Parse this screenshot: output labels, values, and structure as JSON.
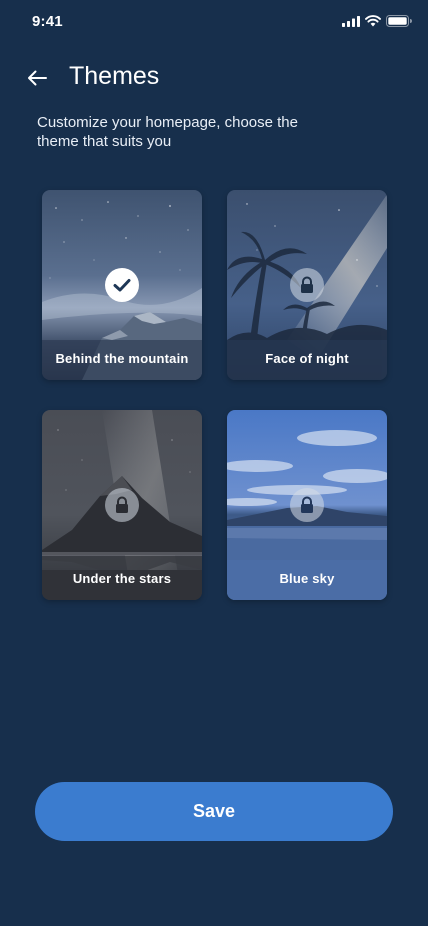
{
  "status_bar": {
    "time": "9:41"
  },
  "header": {
    "title": "Themes"
  },
  "subtitle": "Customize your homepage, choose the theme that suits you",
  "themes": [
    {
      "label": "Behind the mountain",
      "state": "selected"
    },
    {
      "label": "Face of night",
      "state": "locked"
    },
    {
      "label": "Under the stars",
      "state": "locked"
    },
    {
      "label": "Blue sky",
      "state": "locked"
    }
  ],
  "save_label": "Save",
  "colors": {
    "background": "#172f4c",
    "accent": "#3b7ccf",
    "text": "#ffffff"
  },
  "icons": [
    "cellular-signal-icon",
    "wifi-icon",
    "battery-icon",
    "back-arrow-icon",
    "check-icon",
    "lock-icon"
  ]
}
